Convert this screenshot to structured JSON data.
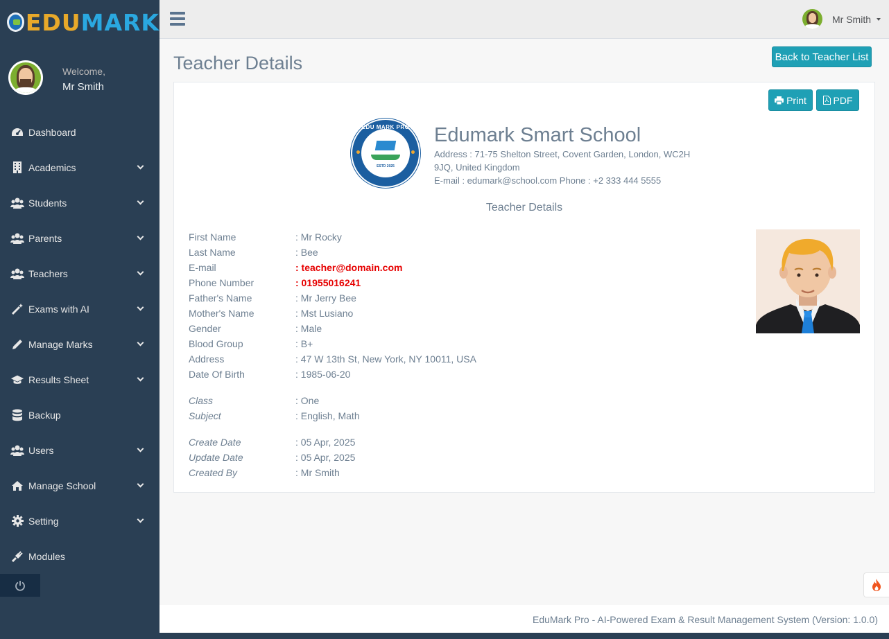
{
  "brand": {
    "edu": "EDU",
    "mark": "MARK"
  },
  "profile": {
    "welcome": "Welcome,",
    "name": "Mr Smith"
  },
  "sidebar": {
    "items": [
      {
        "label": "Dashboard",
        "icon": "dashboard-icon",
        "expandable": false
      },
      {
        "label": "Academics",
        "icon": "building-icon",
        "expandable": true
      },
      {
        "label": "Students",
        "icon": "users-icon",
        "expandable": true
      },
      {
        "label": "Parents",
        "icon": "users-icon",
        "expandable": true
      },
      {
        "label": "Teachers",
        "icon": "users-icon",
        "expandable": true
      },
      {
        "label": "Exams with AI",
        "icon": "magic-wand-icon",
        "expandable": true
      },
      {
        "label": "Manage Marks",
        "icon": "pencil-icon",
        "expandable": true
      },
      {
        "label": "Results Sheet",
        "icon": "graduation-cap-icon",
        "expandable": true
      },
      {
        "label": "Backup",
        "icon": "database-icon",
        "expandable": false
      },
      {
        "label": "Users",
        "icon": "users-icon",
        "expandable": true
      },
      {
        "label": "Manage School",
        "icon": "home-icon",
        "expandable": true
      },
      {
        "label": "Setting",
        "icon": "gear-icon",
        "expandable": true
      },
      {
        "label": "Modules",
        "icon": "plug-icon",
        "expandable": false
      }
    ]
  },
  "topbar": {
    "user_name": "Mr Smith"
  },
  "page": {
    "title": "Teacher Details",
    "back_button": "Back to Teacher List"
  },
  "actions": {
    "print": "Print",
    "pdf": "PDF"
  },
  "school": {
    "logo_text": "EDU MARK PRO",
    "logo_estd": "ESTD 2025",
    "name": "Edumark Smart School",
    "address_line1": "Address : 71-75 Shelton Street, Covent Garden, London, WC2H",
    "address_line2": "9JQ, United Kingdom",
    "contact": "E-mail : edumark@school.com Phone : +2 333 444 5555"
  },
  "section_title": "Teacher Details",
  "details": [
    {
      "label": "First Name",
      "value": ": Mr Rocky"
    },
    {
      "label": "Last Name",
      "value": ": Bee"
    },
    {
      "label": "E-mail",
      "value": ": teacher@domain.com"
    },
    {
      "label": "Phone Number",
      "value": ": 01955016241"
    },
    {
      "label": "Father's Name",
      "value": ": Mr Jerry Bee"
    },
    {
      "label": "Mother's Name",
      "value": ": Mst Lusiano"
    },
    {
      "label": "Gender",
      "value": ": Male"
    },
    {
      "label": "Blood Group",
      "value": ": B+"
    },
    {
      "label": "Address",
      "value": ": 47 W 13th St, New York, NY 10011, USA"
    },
    {
      "label": "Date Of Birth",
      "value": ": 1985-06-20"
    }
  ],
  "academic": [
    {
      "label": "Class",
      "value": ": One"
    },
    {
      "label": "Subject",
      "value": ": English, Math"
    }
  ],
  "meta": [
    {
      "label": "Create Date",
      "value": ": 05 Apr, 2025"
    },
    {
      "label": "Update Date",
      "value": ": 05 Apr, 2025"
    },
    {
      "label": "Created By",
      "value": ": Mr Smith"
    }
  ],
  "footer": {
    "text": "EduMark Pro - AI-Powered Exam & Result Management System (Version: 1.0.0)"
  },
  "colors": {
    "sidebar": "#2a3f54",
    "accent": "#1fa0b5",
    "highlight": "#e60000"
  }
}
